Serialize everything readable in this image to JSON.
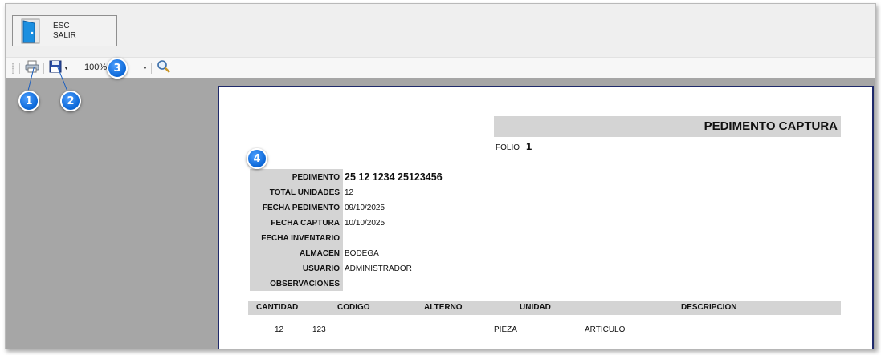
{
  "exit_button": {
    "key": "ESC",
    "label": "SALIR"
  },
  "toolbar": {
    "zoom_value": "100%"
  },
  "markers": [
    "1",
    "2",
    "3",
    "4"
  ],
  "report": {
    "title": "PEDIMENTO CAPTURA",
    "folio_label": "FOLIO",
    "folio_value": "1",
    "fields": [
      {
        "label": "PEDIMENTO",
        "value": "25  12  1234  25123456"
      },
      {
        "label": "TOTAL UNIDADES",
        "value": "12"
      },
      {
        "label": "FECHA PEDIMENTO",
        "value": "09/10/2025"
      },
      {
        "label": "FECHA CAPTURA",
        "value": "10/10/2025"
      },
      {
        "label": "FECHA INVENTARIO",
        "value": ""
      },
      {
        "label": "ALMACEN",
        "value": "BODEGA"
      },
      {
        "label": "USUARIO",
        "value": "ADMINISTRADOR"
      },
      {
        "label": "OBSERVACIONES",
        "value": ""
      }
    ],
    "columns": [
      "CANTIDAD",
      "CODIGO",
      "ALTERNO",
      "UNIDAD",
      "DESCRIPCION"
    ],
    "rows": [
      {
        "cantidad": "12",
        "codigo": "123",
        "alterno": "",
        "unidad": "PIEZA",
        "descripcion": "ARTICULO"
      }
    ]
  },
  "colors": {
    "marker": "#0a66d6",
    "paper_border": "#1f2a6b",
    "viewer_bg": "#a6a6a6"
  }
}
